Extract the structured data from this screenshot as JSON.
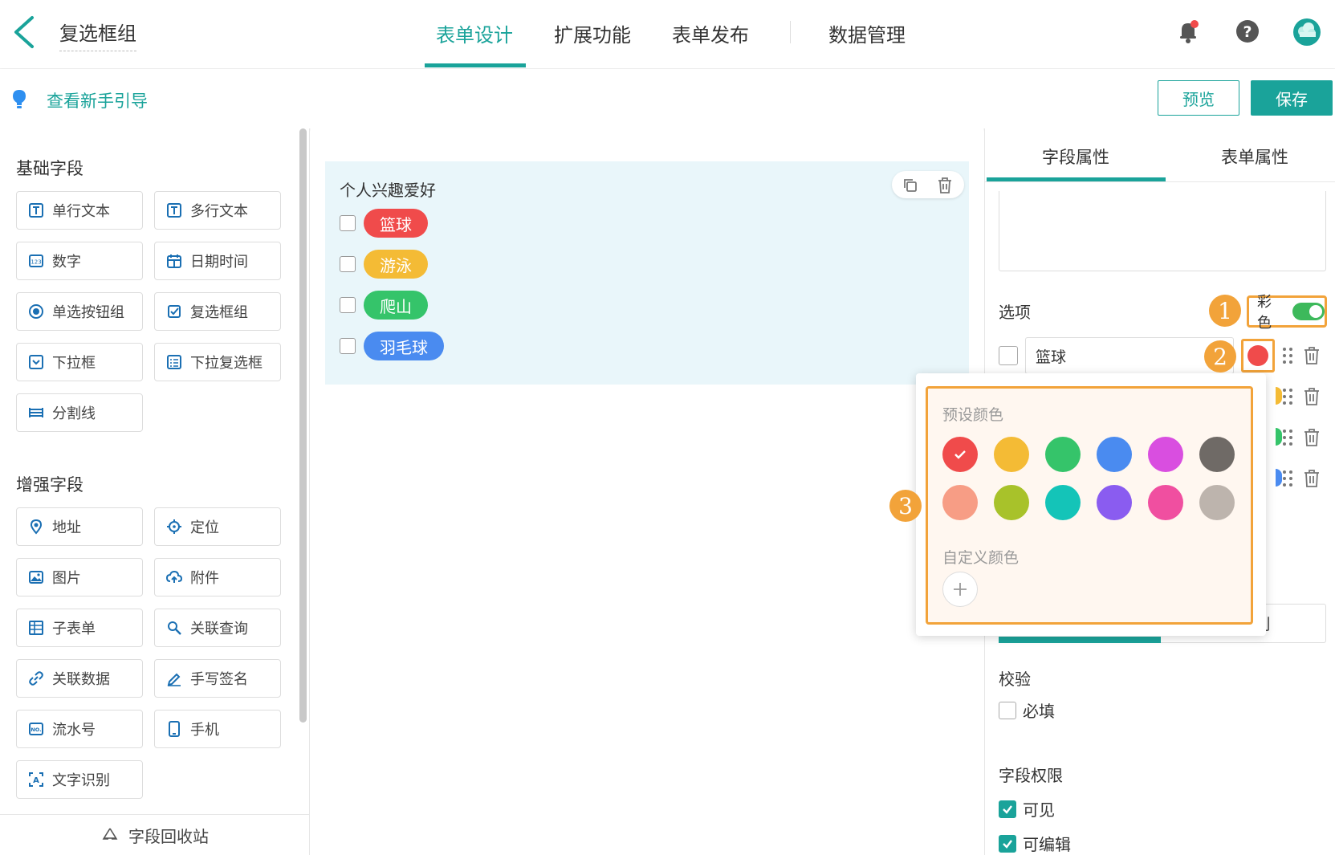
{
  "header": {
    "title": "复选框组",
    "tabs": [
      {
        "label": "表单设计"
      },
      {
        "label": "扩展功能"
      },
      {
        "label": "表单发布"
      },
      {
        "label": "数据管理"
      }
    ]
  },
  "subbar": {
    "guide": "查看新手引导",
    "preview": "预览",
    "save": "保存"
  },
  "left": {
    "basic_title": "基础字段",
    "basic_fields": [
      {
        "label": "单行文本",
        "icon": "text-box-icon"
      },
      {
        "label": "多行文本",
        "icon": "text-box-icon"
      },
      {
        "label": "数字",
        "icon": "number-icon"
      },
      {
        "label": "日期时间",
        "icon": "calendar-icon"
      },
      {
        "label": "单选按钮组",
        "icon": "radio-icon"
      },
      {
        "label": "复选框组",
        "icon": "checkbox-icon"
      },
      {
        "label": "下拉框",
        "icon": "dropdown-icon"
      },
      {
        "label": "下拉复选框",
        "icon": "dropdown-checkbox-icon"
      },
      {
        "label": "分割线",
        "icon": "divider-icon"
      }
    ],
    "enhanced_title": "增强字段",
    "enhanced_fields": [
      {
        "label": "地址",
        "icon": "map-pin-icon"
      },
      {
        "label": "定位",
        "icon": "crosshair-icon"
      },
      {
        "label": "图片",
        "icon": "image-icon"
      },
      {
        "label": "附件",
        "icon": "cloud-upload-icon"
      },
      {
        "label": "子表单",
        "icon": "subform-icon"
      },
      {
        "label": "关联查询",
        "icon": "link-search-icon"
      },
      {
        "label": "关联数据",
        "icon": "link-data-icon"
      },
      {
        "label": "手写签名",
        "icon": "pen-icon"
      },
      {
        "label": "流水号",
        "icon": "serial-number-icon"
      },
      {
        "label": "手机",
        "icon": "phone-icon"
      },
      {
        "label": "文字识别",
        "icon": "ocr-icon"
      }
    ],
    "recycle": "字段回收站"
  },
  "canvas": {
    "field_title": "个人兴趣爱好",
    "options": [
      {
        "label": "篮球",
        "color": "#f04b4b"
      },
      {
        "label": "游泳",
        "color": "#f4bb35"
      },
      {
        "label": "爬山",
        "color": "#35c46a"
      },
      {
        "label": "羽毛球",
        "color": "#4a8bf0"
      }
    ]
  },
  "right": {
    "tabs": [
      {
        "label": "字段属性"
      },
      {
        "label": "表单属性"
      }
    ],
    "options_label": "选项",
    "colorful_label": "彩色",
    "colorful_on": true,
    "first_option": "篮球",
    "first_option_color": "#f04b4b",
    "partial_text": "刂",
    "validation_label": "校验",
    "required_label": "必填",
    "permission_label": "字段权限",
    "visible_label": "可见",
    "editable_label": "可编辑"
  },
  "popover": {
    "preset_label": "预设颜色",
    "preset_colors": [
      "#f04b4b",
      "#f4bb35",
      "#35c46a",
      "#4a8bf0",
      "#d94ee0",
      "#6f6a66",
      "#f79d85",
      "#a8c22a",
      "#14c4b8",
      "#8a5cf0",
      "#f04fa0",
      "#bdb4ad"
    ],
    "selected_index": 0,
    "custom_label": "自定义颜色"
  },
  "markers": [
    "1",
    "2",
    "3"
  ],
  "colors": {
    "accent": "#1aa39a",
    "highlight": "#f2a33a"
  }
}
